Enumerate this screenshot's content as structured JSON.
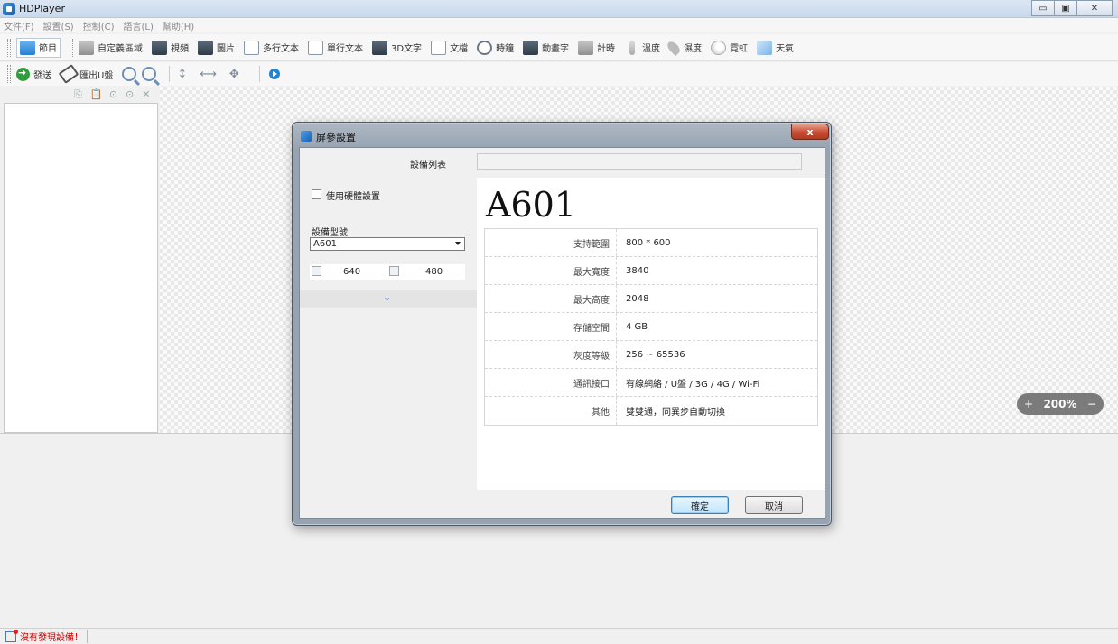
{
  "window": {
    "title": "HDPlayer",
    "controls": [
      "▭",
      "▣",
      "✕"
    ]
  },
  "menu": [
    "文件(F)",
    "設置(S)",
    "控制(C)",
    "語言(L)",
    "幫助(H)"
  ],
  "toolbar1": [
    {
      "label": "節目",
      "icon": "program-icon"
    },
    {
      "label": "自定義區域",
      "icon": "custom-area-icon"
    },
    {
      "label": "視頻",
      "icon": "video-icon"
    },
    {
      "label": "圖片",
      "icon": "picture-icon"
    },
    {
      "label": "多行文本",
      "icon": "multiline-text-icon"
    },
    {
      "label": "單行文本",
      "icon": "single-line-text-icon"
    },
    {
      "label": "3D文字",
      "icon": "3d-text-icon"
    },
    {
      "label": "文檔",
      "icon": "document-icon"
    },
    {
      "label": "時鐘",
      "icon": "clock-icon"
    },
    {
      "label": "動畫字",
      "icon": "animated-text-icon"
    },
    {
      "label": "計時",
      "icon": "timer-icon"
    },
    {
      "label": "溫度",
      "icon": "thermometer-icon"
    },
    {
      "label": "濕度",
      "icon": "humidity-icon"
    },
    {
      "label": "霓虹",
      "icon": "neon-icon"
    },
    {
      "label": "天氣",
      "icon": "weather-icon"
    }
  ],
  "toolbar2": {
    "send": "發送",
    "export_usb": "匯出U盤"
  },
  "zoom": {
    "plus": "+",
    "value": "200%",
    "minus": "−"
  },
  "status": {
    "text": "沒有發現設備！"
  },
  "dialog": {
    "title": "屏參設置",
    "close": "x",
    "device_list_label": "設備列表",
    "use_hardware_label": "使用硬體設置",
    "model_label": "設備型號",
    "model_selected": "A601",
    "width": "640",
    "height": "480",
    "model_title": "A601",
    "specs": [
      {
        "key": "支持範圍",
        "value": "800 * 600"
      },
      {
        "key": "最大寬度",
        "value": "3840"
      },
      {
        "key": "最大高度",
        "value": "2048"
      },
      {
        "key": "存儲空間",
        "value": "4 GB"
      },
      {
        "key": "灰度等級",
        "value": "256 ~ 65536"
      },
      {
        "key": "通訊接口",
        "value": "有線網絡 / U盤 / 3G / 4G / Wi-Fi"
      },
      {
        "key": "其他",
        "value": "雙雙通，同異步自動切換"
      }
    ],
    "ok": "確定",
    "cancel": "取消"
  }
}
